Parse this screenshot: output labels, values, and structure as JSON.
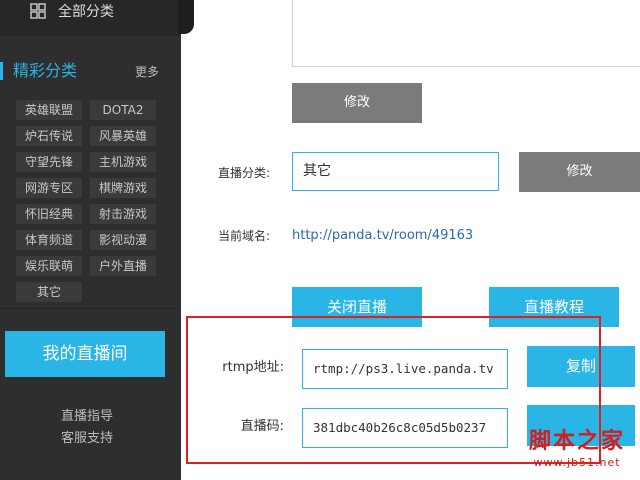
{
  "sidebar": {
    "all_categories": "全部分类",
    "section_title": "精彩分类",
    "more": "更多",
    "categories": [
      "英雄联盟",
      "DOTA2",
      "炉石传说",
      "风暴英雄",
      "守望先锋",
      "主机游戏",
      "网游专区",
      "棋牌游戏",
      "怀旧经典",
      "射击游戏",
      "体育频道",
      "影视动漫",
      "娱乐联萌",
      "户外直播",
      "其它"
    ],
    "my_room": "我的直播间",
    "links": [
      "直播指导",
      "客服支持"
    ]
  },
  "main": {
    "modify_label": "修改",
    "category_label": "直播分类:",
    "category_value": "其它",
    "domain_label": "当前域名:",
    "domain_value": "http://panda.tv/room/49163",
    "close_live": "关闭直播",
    "live_tutorial": "直播教程",
    "rtmp_label": "rtmp地址:",
    "rtmp_value": "rtmp://ps3.live.panda.tv",
    "code_label": "直播码:",
    "code_value": "381dbc40b26c8c05d5b0237",
    "copy_label": "复制"
  },
  "watermark": {
    "main": "脚本之家",
    "sub": "www.jb51.net"
  },
  "colors": {
    "accent": "#29b6e7",
    "sidebar_bg": "#2e2e2e",
    "highlight_border": "#e02020"
  }
}
